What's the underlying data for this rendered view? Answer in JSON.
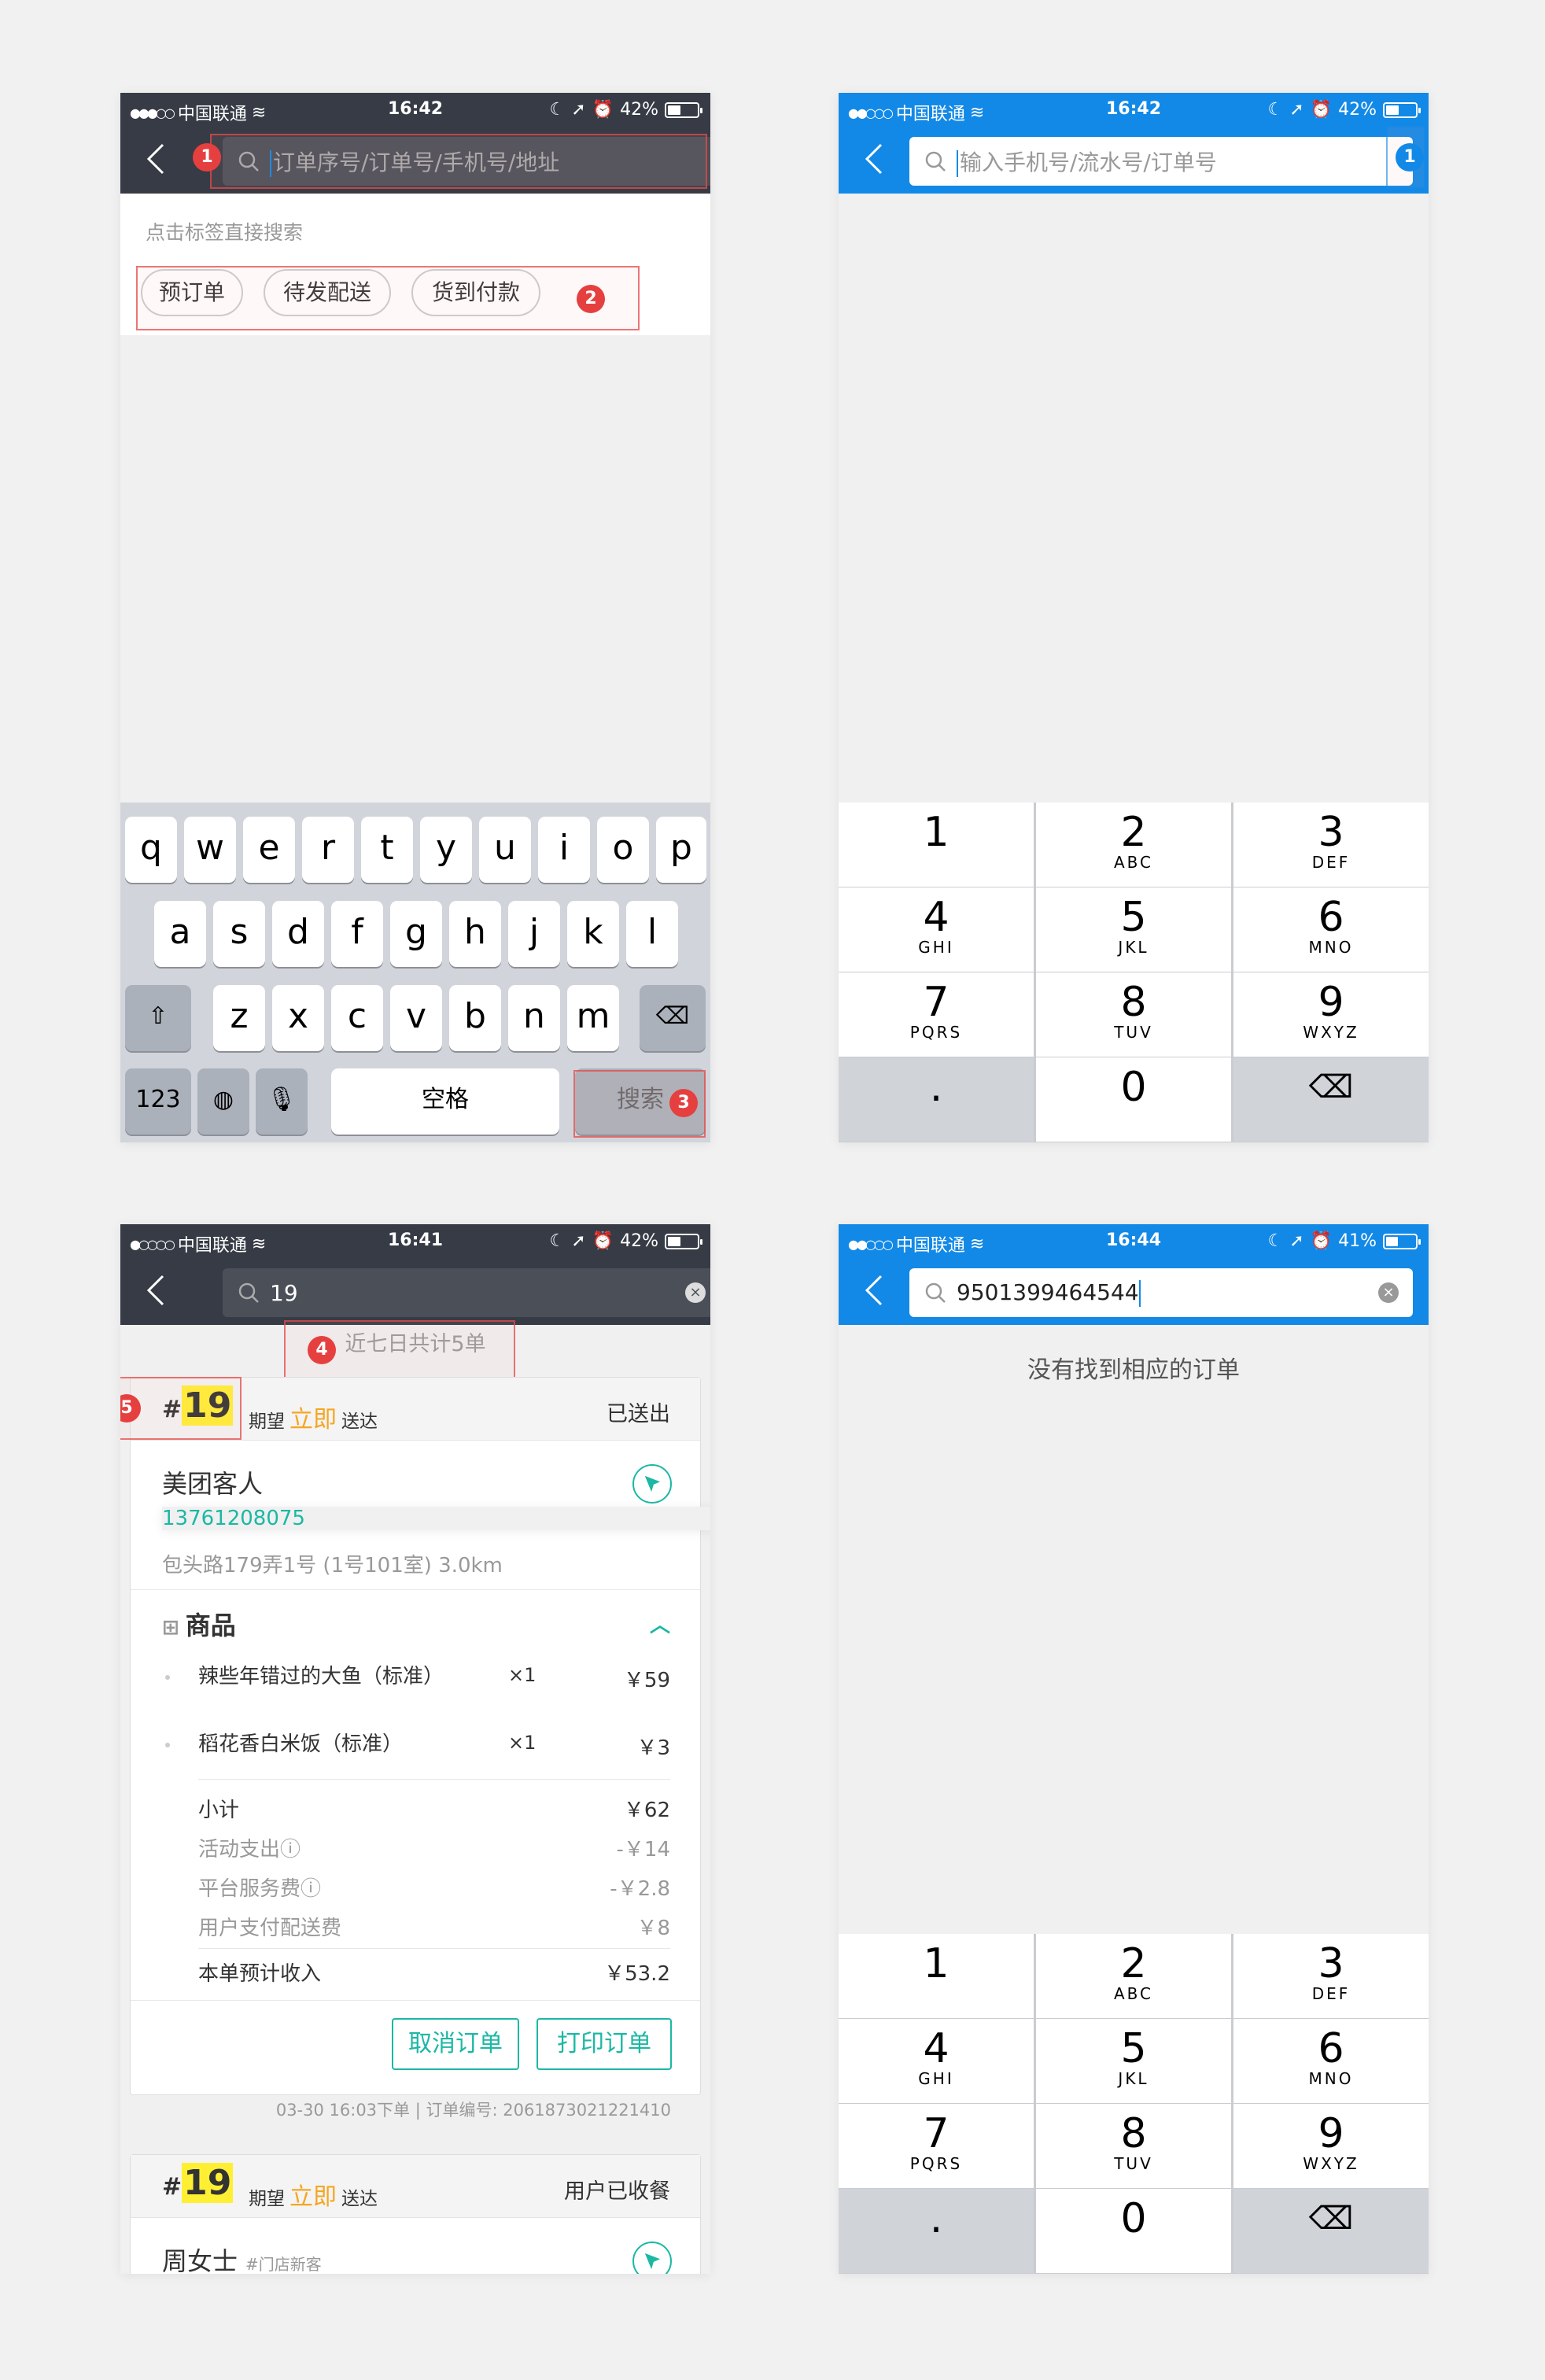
{
  "status_bars": [
    {
      "carrier": "中国联通",
      "signal": "●●●○○",
      "time": "16:42",
      "battery": "42%",
      "battery_level": 0.42
    },
    {
      "carrier": "中国联通",
      "signal": "●●○○○",
      "time": "16:42",
      "battery": "42%",
      "battery_level": 0.42
    },
    {
      "carrier": "中国联通",
      "signal": "●○○○○",
      "time": "16:41",
      "battery": "42%",
      "battery_level": 0.42
    },
    {
      "carrier": "中国联通",
      "signal": "●●○○○",
      "time": "16:44",
      "battery": "41%",
      "battery_level": 0.41
    }
  ],
  "screen1": {
    "search_placeholder": "订单序号/订单号/手机号/地址",
    "tag_hint": "点击标签直接搜索",
    "tags": [
      "预订单",
      "待发配送",
      "货到付款"
    ],
    "keyboard": {
      "row1": [
        "q",
        "w",
        "e",
        "r",
        "t",
        "y",
        "u",
        "i",
        "o",
        "p"
      ],
      "row2": [
        "a",
        "s",
        "d",
        "f",
        "g",
        "h",
        "j",
        "k",
        "l"
      ],
      "row3": [
        "z",
        "x",
        "c",
        "v",
        "b",
        "n",
        "m"
      ],
      "numbers_key": "123",
      "space_key": "空格",
      "search_key": "搜索"
    },
    "badges": [
      "1",
      "2",
      "3"
    ]
  },
  "screen2": {
    "search_placeholder": "输入手机号/流水号/订单号",
    "badge": "1"
  },
  "numpad": [
    {
      "d": "1",
      "l": ""
    },
    {
      "d": "2",
      "l": "ABC"
    },
    {
      "d": "3",
      "l": "DEF"
    },
    {
      "d": "4",
      "l": "GHI"
    },
    {
      "d": "5",
      "l": "JKL"
    },
    {
      "d": "6",
      "l": "MNO"
    },
    {
      "d": "7",
      "l": "PQRS"
    },
    {
      "d": "8",
      "l": "TUV"
    },
    {
      "d": "9",
      "l": "WXYZ"
    },
    {
      "d": ".",
      "l": ""
    },
    {
      "d": "0",
      "l": ""
    },
    {
      "d": "⌫",
      "l": ""
    }
  ],
  "screen3": {
    "search_value": "19",
    "count_text": "近七日共计5单",
    "badges": [
      "4",
      "5"
    ],
    "order1": {
      "hash": "#",
      "number": "19",
      "expect_prefix": "期望",
      "expect_time": "立即",
      "expect_suffix": "送达",
      "status": "已送出",
      "customer": "美团客人",
      "phone": "13761208075",
      "address": "包头路179弄1号 (1号101室)  3.0km",
      "goods_title": "商品",
      "items": [
        {
          "name": "辣些年错过的大鱼（标准）",
          "qty": "×1",
          "price": "￥59"
        },
        {
          "name": "稻花香白米饭（标准）",
          "qty": "×1",
          "price": "￥3"
        }
      ],
      "fees": [
        {
          "label": "小计",
          "value": "￥62"
        },
        {
          "label": "活动支出",
          "value": "-￥14"
        },
        {
          "label": "平台服务费",
          "value": "-￥2.8"
        },
        {
          "label": "用户支付配送费",
          "value": "￥8"
        }
      ],
      "total_label": "本单预计收入",
      "total_value": "￥53.2",
      "cancel_btn": "取消订单",
      "print_btn": "打印订单",
      "meta": "03-30 16:03下单  |  订单编号:  2061873021221410"
    },
    "order2": {
      "hash": "#",
      "number": "19",
      "expect_prefix": "期望",
      "expect_time": "立即",
      "expect_suffix": "送达",
      "status": "用户已收餐",
      "customer": "周女士",
      "customer_tag": "#门店新客"
    }
  },
  "screen4": {
    "search_value": "9501399464544",
    "empty_text": "没有找到相应的订单"
  },
  "colors": {
    "dark_nav": "#363b45",
    "blue_nav": "#1289e7",
    "annotation_red": "#e5403f",
    "teal": "#1bb8a4",
    "orange": "#f5a623",
    "highlight": "#ffef33"
  }
}
